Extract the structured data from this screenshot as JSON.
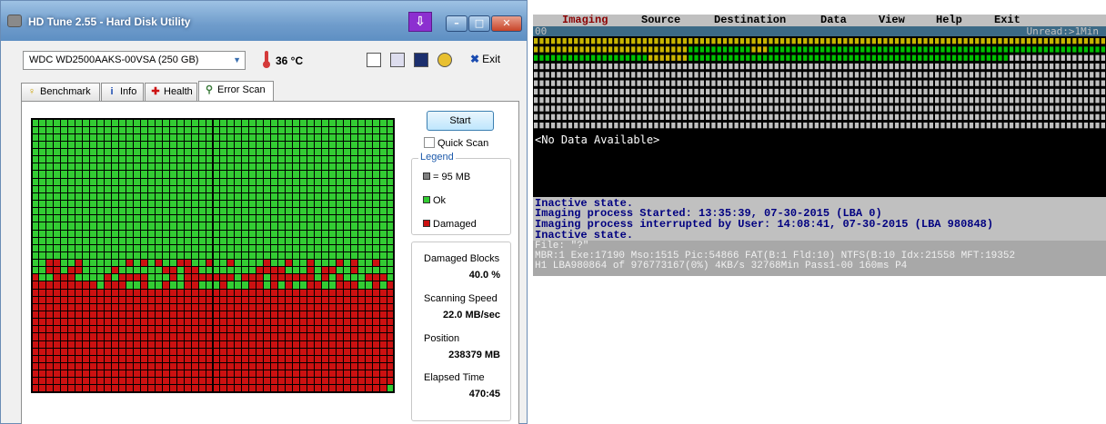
{
  "hdtune": {
    "title": "HD Tune 2.55 - Hard Disk Utility",
    "drive": "WDC WD2500AAKS-00VSA (250 GB)",
    "temperature": "36 °C",
    "exit_label": "Exit",
    "tabs": [
      {
        "label": "Benchmark",
        "icon": "benchmark-icon"
      },
      {
        "label": "Info",
        "icon": "info-icon"
      },
      {
        "label": "Health",
        "icon": "health-icon"
      },
      {
        "label": "Error Scan",
        "icon": "magnifier-icon"
      }
    ],
    "start_label": "Start",
    "quick_scan_label": "Quick Scan",
    "quick_scan_checked": false,
    "legend": {
      "title": "Legend",
      "block_size": "= 95 MB",
      "ok": "Ok",
      "damaged": "Damaged"
    },
    "stats": {
      "damaged_blocks_label": "Damaged Blocks",
      "damaged_blocks_value": "40.0 %",
      "scan_speed_label": "Scanning Speed",
      "scan_speed_value": "22.0 MB/sec",
      "position_label": "Position",
      "position_value": "238379 MB",
      "elapsed_label": "Elapsed Time",
      "elapsed_value": "470:45"
    },
    "colors": {
      "ok": "#33cc33",
      "damaged": "#cc1111",
      "unscanned": "#808080"
    },
    "scan_grid": {
      "columns": 50,
      "rows": 37,
      "damaged_fraction": 0.4,
      "first_damaged_row": 19,
      "solid_damaged_from_row": 23
    }
  },
  "imaging": {
    "menu": [
      "Imaging",
      "Source",
      "Destination",
      "Data",
      "View",
      "Help",
      "Exit"
    ],
    "status_left": "00",
    "status_right": "Unread:>1Min",
    "no_data": "<No Data Available>",
    "log": [
      "Inactive state.",
      "Imaging process Started: 13:35:39, 07-30-2015 (LBA 0)",
      "Imaging process interrupted by User: 14:08:41, 07-30-2015 (LBA 980848)",
      "Inactive state."
    ],
    "info": [
      "File: \"?\"",
      "MBR:1 Exe:17190 Mso:1515 Pic:54866 FAT(B:1 Fld:10) NTFS(B:10 Idx:21558 MFT:19352",
      "H1 LBA980864 of 976773167(0%) 4KB/s 32768Min Pass1-00 160ms P4"
    ],
    "colors": {
      "read_ok": "#00c000",
      "unread": "#c0c0c0",
      "pending": "#c8b400"
    }
  }
}
